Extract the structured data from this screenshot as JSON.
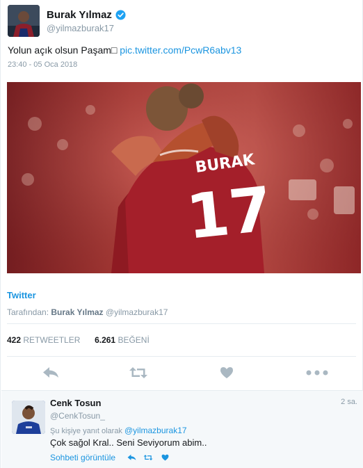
{
  "tweet": {
    "author_name": "Burak Yılmaz",
    "author_handle": "@yilmazburak17",
    "text": "Yolun açık olsun Paşam□",
    "link": "pic.twitter.com/PcwR6abv13",
    "timestamp": "23:40 - 05 Oca 2018",
    "photo_jersey_name": "BURAK",
    "photo_jersey_number": "17"
  },
  "source": {
    "title": "Twitter",
    "by_label": "Tarafından:",
    "by_name": "Burak Yılmaz",
    "by_handle": "@yilmazburak17"
  },
  "stats": {
    "retweets_count": "422",
    "retweets_label": "RETWEETLER",
    "likes_count": "6.261",
    "likes_label": "BEĞENİ"
  },
  "reply": {
    "author_name": "Cenk Tosun",
    "author_handle": "@CenkTosun_",
    "age": "2 sa.",
    "replying_label": "Şu kişiye yanıt olarak",
    "replying_handle": "@yilmazburak17",
    "text": "Çok sağol Kral.. Seni Seviyorum abim..",
    "view_conversation": "Sohbeti görüntüle"
  },
  "icons": {
    "verified": "verified-badge-icon",
    "reply": "reply-icon",
    "retweet": "retweet-icon",
    "like": "heart-icon",
    "more": "more-icon"
  },
  "colors": {
    "link": "#1b95e0",
    "muted": "#8899a6",
    "icon": "#aab8c2",
    "verified": "#1da1f2",
    "reply_bg": "#f5f8fa"
  }
}
